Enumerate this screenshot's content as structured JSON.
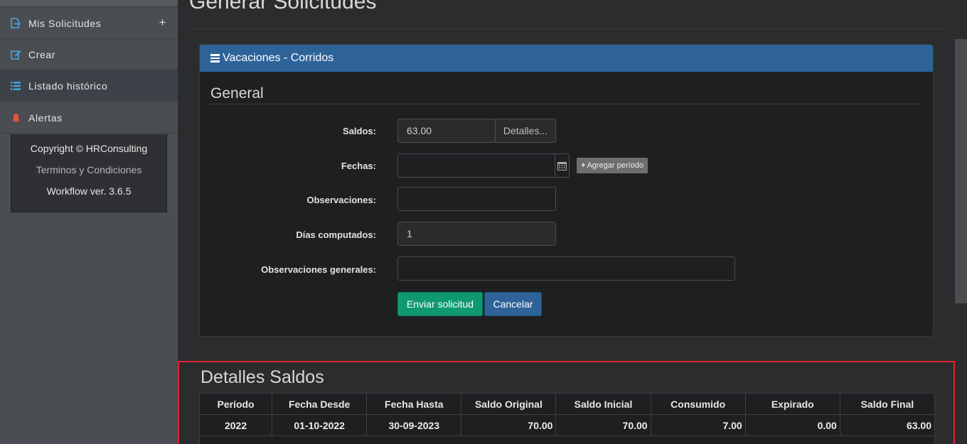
{
  "sidebar": {
    "items": [
      {
        "label": "Mis Solicitudes",
        "icon": "sign-out-icon",
        "expand": "+"
      },
      {
        "label": "Crear",
        "icon": "edit-icon"
      },
      {
        "label": "Listado histórico",
        "icon": "list-icon"
      },
      {
        "label": "Alertas",
        "icon": "bell-icon"
      }
    ],
    "footer": {
      "copyright": "Copyright © HRConsulting",
      "terms": "Terminos y Condiciones",
      "version": "Workflow ver. 3.6.5"
    }
  },
  "page": {
    "title": "Generar Solicitudes"
  },
  "panel": {
    "heading": "Vacaciones - Corridos",
    "section_title": "General",
    "form": {
      "saldos_label": "Saldos:",
      "saldos_value": "63.00",
      "detalles_button": "Detalles...",
      "fechas_label": "Fechas:",
      "fechas_value": "",
      "add_period_button": "Agregar período",
      "observaciones_label": "Observaciones:",
      "observaciones_value": "",
      "dias_label": "Días computados:",
      "dias_value": "1",
      "obs_generales_label": "Observaciones generales:",
      "obs_generales_value": "",
      "submit_button": "Enviar solicitud",
      "cancel_button": "Cancelar"
    }
  },
  "details": {
    "title": "Detalles Saldos",
    "columns": [
      "Período",
      "Fecha Desde",
      "Fecha Hasta",
      "Saldo Original",
      "Saldo Inicial",
      "Consumido",
      "Expirado",
      "Saldo Final"
    ],
    "rows": [
      [
        "2022",
        "01-10-2022",
        "30-09-2023",
        "70.00",
        "70.00",
        "7.00",
        "0.00",
        "63.00"
      ]
    ]
  },
  "colors": {
    "panel_header": "#2d6399",
    "submit": "#0e9a6e",
    "cancel": "#2d6399",
    "highlight_border": "#e0262e",
    "alert_icon": "#e8553e",
    "nav_icon": "#4aa3df"
  }
}
